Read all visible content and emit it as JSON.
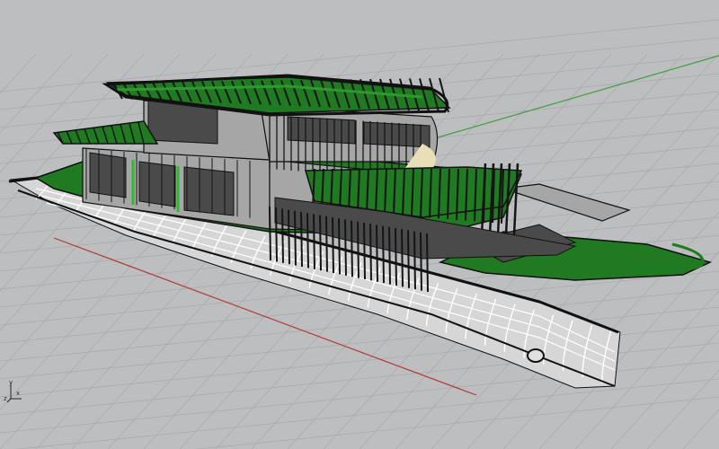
{
  "viewport": {
    "view": "perspective",
    "background_color": "#bdbec0",
    "grid_color": "#a9aaac",
    "x_axis_color": "#b23a3a",
    "y_axis_color": "#3f9f3f"
  },
  "model": {
    "hull_color": "#d6d6d6",
    "hull_line_color": "#ffffff",
    "edge_color": "#111111",
    "deck_color": "#1f7a22",
    "deck_highlight_color": "#2e9a2e",
    "glass_color": "#4a4a4a",
    "frame_color": "#151515",
    "wall_color": "#a6a6a6"
  },
  "axis_widget": {
    "icon": "axis-triad-icon",
    "x_label": "x",
    "y_label": "y",
    "z_label": "z"
  }
}
